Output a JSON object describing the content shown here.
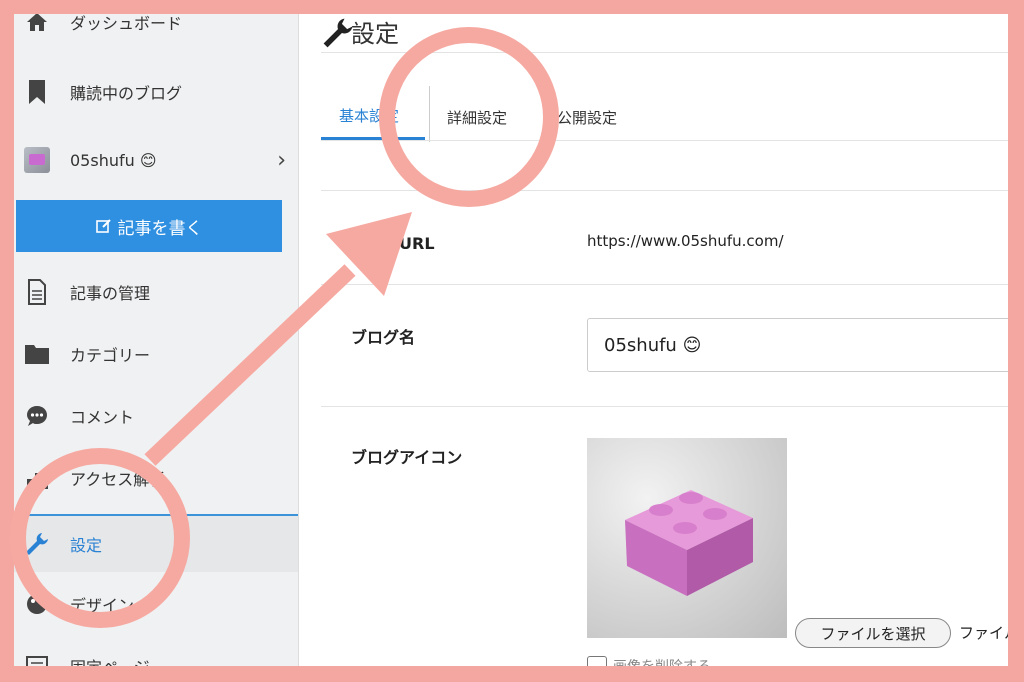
{
  "sidebar": {
    "items": [
      {
        "label": "ダッシュボード",
        "icon": "home-icon"
      },
      {
        "label": "購読中のブログ",
        "icon": "bookmark-icon"
      },
      {
        "label": "05shufu 😊",
        "icon": "blog-thumbnail"
      },
      {
        "label": "記事の管理",
        "icon": "document-icon"
      },
      {
        "label": "カテゴリー",
        "icon": "folder-icon"
      },
      {
        "label": "コメント",
        "icon": "comment-icon"
      },
      {
        "label": "アクセス解析",
        "icon": "bar-chart-icon"
      },
      {
        "label": "設定",
        "icon": "wrench-icon"
      },
      {
        "label": "デザイン",
        "icon": "palette-icon"
      },
      {
        "label": "固定ページ",
        "icon": "page-icon"
      }
    ],
    "write_button": "記事を書く"
  },
  "main": {
    "title": "設定",
    "tabs": [
      {
        "label": "基本設定"
      },
      {
        "label": "詳細設定"
      },
      {
        "label": "公開設定"
      }
    ],
    "url_label": "ブログURL",
    "url_value": "https://www.05shufu.com/",
    "blog_name_label": "ブログ名",
    "blog_name_value": "05shufu 😊",
    "blog_icon_label": "ブログアイコン",
    "file_button": "ファイルを選択",
    "file_status": "ファイル",
    "delete_icon_label": "画像を削除する"
  },
  "colors": {
    "accent": "#2f8fe0",
    "frame": "#f4a7a0",
    "annotation": "#f6a9a1"
  }
}
